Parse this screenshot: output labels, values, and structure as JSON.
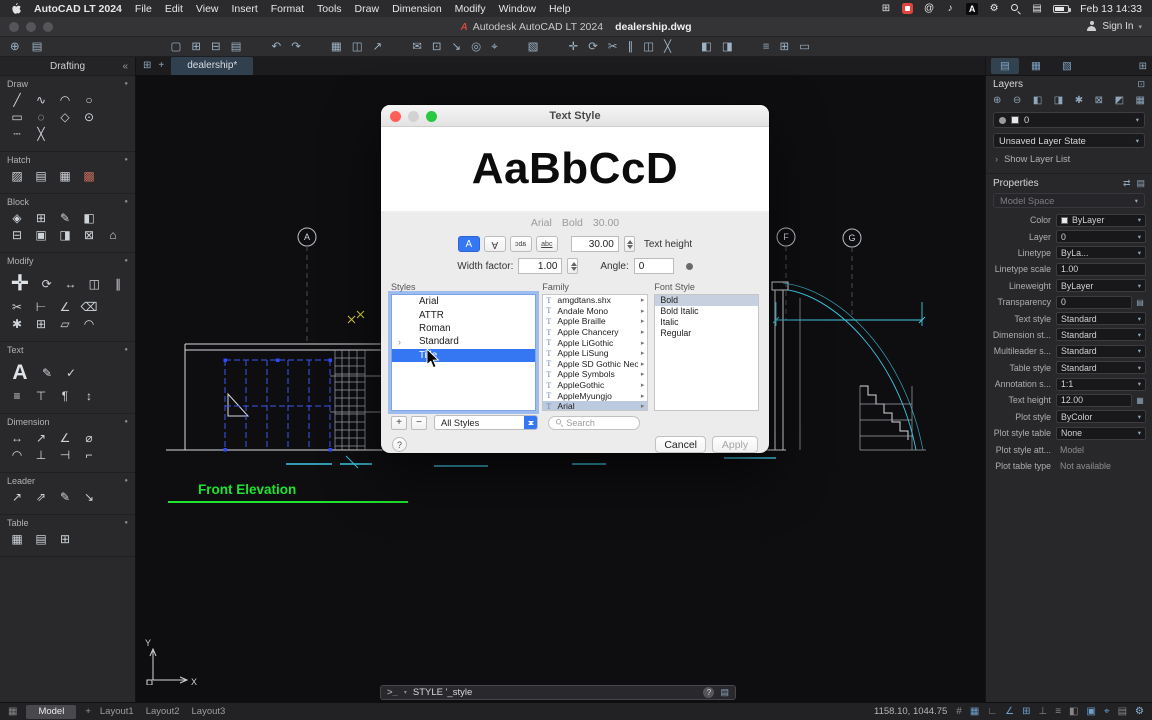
{
  "menubar": {
    "app_name": "AutoCAD LT 2024",
    "items": [
      "File",
      "Edit",
      "View",
      "Insert",
      "Format",
      "Tools",
      "Draw",
      "Dimension",
      "Modify",
      "Window",
      "Help"
    ],
    "status_icons": [
      {
        "name": "display-icon",
        "glyph": "⊞"
      },
      {
        "name": "screen-record-icon",
        "cls": "rec"
      },
      {
        "name": "at-circle-icon",
        "glyph": "@"
      },
      {
        "name": "volume-icon",
        "glyph": "♪"
      },
      {
        "name": "input-source-icon",
        "glyph": "A",
        "cls": "boxed"
      },
      {
        "name": "gear-icon",
        "glyph": "⚙"
      },
      {
        "name": "spotlight-search-icon",
        "cls": "mag"
      },
      {
        "name": "control-center-icon",
        "glyph": "▤"
      },
      {
        "name": "battery-icon",
        "cls": "battery"
      }
    ],
    "clock": "Feb 13 14:33"
  },
  "titlebar": {
    "app_title": "Autodesk AutoCAD LT 2024",
    "doc_name": "dealership.dwg",
    "sign_in_label": "Sign In"
  },
  "toolbar": {
    "groups": [
      [
        {
          "name": "new",
          "glyph": "▢"
        },
        {
          "name": "open",
          "glyph": "⊞"
        },
        {
          "name": "save",
          "glyph": "⊟"
        },
        {
          "name": "print",
          "glyph": "▤"
        }
      ],
      [
        {
          "name": "undo",
          "glyph": "↶"
        },
        {
          "name": "redo",
          "glyph": "↷"
        }
      ],
      [
        {
          "name": "plot",
          "glyph": "▦"
        },
        {
          "name": "plot-preview",
          "glyph": "◫"
        },
        {
          "name": "publish",
          "glyph": "↗"
        }
      ],
      [
        {
          "name": "mail",
          "glyph": "✉"
        },
        {
          "name": "layout",
          "glyph": "⊡"
        },
        {
          "name": "import",
          "glyph": "↘"
        },
        {
          "name": "osnap",
          "glyph": "◎"
        },
        {
          "name": "center",
          "glyph": "⌖"
        }
      ],
      [
        {
          "name": "measure",
          "glyph": "▧"
        }
      ],
      [
        {
          "name": "move",
          "glyph": "✛"
        },
        {
          "name": "rotate",
          "glyph": "⟳"
        },
        {
          "name": "trim",
          "glyph": "✂"
        },
        {
          "name": "offset",
          "glyph": "∥"
        },
        {
          "name": "mirror",
          "glyph": "◫"
        },
        {
          "name": "erase",
          "glyph": "╳"
        }
      ],
      [
        {
          "name": "group",
          "glyph": "◧"
        },
        {
          "name": "ungroup",
          "glyph": "◨"
        }
      ],
      [
        {
          "name": "list",
          "glyph": "≡"
        },
        {
          "name": "grid-view",
          "glyph": "⊞"
        },
        {
          "name": "properties",
          "glyph": "▭"
        }
      ]
    ]
  },
  "doc_tabs": {
    "active": "dealership*"
  },
  "left_panel": {
    "title": "Drafting",
    "sections": [
      {
        "label": "Draw",
        "rows": [
          [
            {
              "n": "line",
              "g": "╱"
            },
            {
              "n": "polyline",
              "g": "∿"
            },
            {
              "n": "arc",
              "g": "◠"
            },
            {
              "n": "circle",
              "g": "○"
            }
          ],
          [
            {
              "n": "rectangle",
              "g": "▭"
            },
            {
              "n": "ellipse",
              "g": "◌"
            },
            {
              "n": "polygon",
              "g": "◇"
            },
            {
              "n": "point",
              "g": "⊙"
            }
          ],
          [
            {
              "n": "construction-line",
              "g": "┄"
            },
            {
              "n": "xline",
              "g": "╳"
            }
          ]
        ]
      },
      {
        "label": "Hatch",
        "rows": [
          [
            {
              "n": "hatch",
              "g": "▨"
            },
            {
              "n": "gradient",
              "g": "▤"
            },
            {
              "n": "boundary",
              "g": "▦"
            },
            {
              "n": "solid-fill",
              "g": "▩",
              "c": "#c26a5a"
            }
          ]
        ]
      },
      {
        "label": "Block",
        "rows": [
          [
            {
              "n": "insert-block",
              "g": "◈"
            },
            {
              "n": "create-block",
              "g": "⊞"
            },
            {
              "n": "edit-block",
              "g": "✎"
            },
            {
              "n": "define-attributes",
              "g": "◧"
            }
          ],
          [
            {
              "n": "write-block",
              "g": "⊟"
            },
            {
              "n": "base-point",
              "g": "▣"
            },
            {
              "n": "attach",
              "g": "◨"
            },
            {
              "n": "clip",
              "g": "⊠"
            },
            {
              "n": "adjust",
              "g": "⌂"
            }
          ]
        ]
      },
      {
        "label": "Modify",
        "rows": [
          [
            {
              "n": "move",
              "g": "✛",
              "big": true
            },
            {
              "n": "rotate",
              "g": "⟳"
            },
            {
              "n": "stretch",
              "g": "↔"
            },
            {
              "n": "mirror",
              "g": "◫"
            },
            {
              "n": "offset",
              "g": "∥"
            }
          ],
          [
            {
              "n": "trim",
              "g": "✂"
            },
            {
              "n": "extend",
              "g": "⊢"
            },
            {
              "n": "chamfer",
              "g": "∠"
            },
            {
              "n": "erase",
              "g": "⌫"
            }
          ],
          [
            {
              "n": "explode",
              "g": "✱"
            },
            {
              "n": "array",
              "g": "⊞"
            },
            {
              "n": "scale",
              "g": "▱"
            },
            {
              "n": "fillet",
              "g": "◠"
            }
          ]
        ]
      },
      {
        "label": "Text",
        "rows": [
          [
            {
              "n": "multiline-text",
              "g": "A",
              "big": true
            },
            {
              "n": "edit-text",
              "g": "✎"
            },
            {
              "n": "spell-check",
              "g": "✓"
            }
          ],
          [
            {
              "n": "text-align",
              "g": "≡"
            },
            {
              "n": "text-style",
              "g": "⊤"
            },
            {
              "n": "paragraph",
              "g": "¶"
            },
            {
              "n": "text-height",
              "g": "↕"
            }
          ]
        ]
      },
      {
        "label": "Dimension",
        "rows": [
          [
            {
              "n": "linear-dimension",
              "g": "↔"
            },
            {
              "n": "aligned-dimension",
              "g": "↗"
            },
            {
              "n": "angular-dimension",
              "g": "∠"
            },
            {
              "n": "diameter-dimension",
              "g": "⌀"
            }
          ],
          [
            {
              "n": "arc-length",
              "g": "◠"
            },
            {
              "n": "perpendicular",
              "g": "⊥"
            },
            {
              "n": "baseline",
              "g": "⊣"
            },
            {
              "n": "ordinate",
              "g": "⌐"
            }
          ]
        ]
      },
      {
        "label": "Leader",
        "rows": [
          [
            {
              "n": "multileader",
              "g": "↗"
            },
            {
              "n": "add-leader",
              "g": "⇗"
            },
            {
              "n": "edit-leader",
              "g": "✎"
            },
            {
              "n": "align-leader",
              "g": "↘"
            }
          ]
        ]
      },
      {
        "label": "Table",
        "rows": [
          [
            {
              "n": "table",
              "g": "▦"
            },
            {
              "n": "table-style",
              "g": "▤"
            },
            {
              "n": "insert-table",
              "g": "⊞"
            }
          ]
        ]
      }
    ]
  },
  "canvas": {
    "bubbles": [
      "A",
      "F",
      "G"
    ],
    "label": "Front Elevation",
    "ucs": {
      "x": "X",
      "y": "Y"
    }
  },
  "dialog": {
    "title": "Text Style",
    "preview_text": "AaBbCcD",
    "preview_font": "Arial",
    "preview_style": "Bold",
    "preview_size": "30.00",
    "toggles": [
      {
        "name": "annotative-toggle",
        "glyph": "A",
        "on": true
      },
      {
        "name": "upside-down-toggle",
        "glyph": "A",
        "cls": "flip"
      },
      {
        "name": "backwards-toggle",
        "glyph": "abc",
        "cls": "mirror"
      },
      {
        "name": "vertical-toggle",
        "glyph": "abc",
        "cls": "under"
      }
    ],
    "text_height_value": "30.00",
    "text_height_label": "Text height",
    "width_factor_label": "Width factor:",
    "width_factor_value": "1.00",
    "angle_label": "Angle:",
    "angle_value": "0",
    "styles_label": "Styles",
    "styles": [
      "Arial",
      "ATTR",
      "Roman",
      "Standard",
      "Title"
    ],
    "selected_style": "Title",
    "disclosure_style": "Standard",
    "family_label": "Family",
    "families": [
      "amgdtans.shx",
      "Andale Mono",
      "Apple Braille",
      "Apple Chancery",
      "Apple LiGothic",
      "Apple LiSung",
      "Apple SD Gothic Neo",
      "Apple Symbols",
      "AppleGothic",
      "AppleMyungjo",
      "Arial"
    ],
    "selected_family": "Arial",
    "font_style_label": "Font Style",
    "font_styles": [
      "Bold",
      "Bold Italic",
      "Italic",
      "Regular"
    ],
    "selected_font_style": "Bold",
    "add_label": "+",
    "remove_label": "−",
    "filter_value": "All Styles",
    "search_placeholder": "Search",
    "help_label": "?",
    "cancel_label": "Cancel",
    "apply_label": "Apply"
  },
  "right_panel": {
    "panel_tabs": [
      {
        "name": "palette-tab-layers",
        "glyph": "▤"
      },
      {
        "name": "palette-tab-properties",
        "glyph": "▦"
      },
      {
        "name": "palette-tab-reference",
        "glyph": "▧"
      }
    ],
    "corner_icon": {
      "name": "panel-grid-icon",
      "glyph": "⊞"
    },
    "layers": {
      "title": "Layers",
      "tool_icons": [
        {
          "name": "new-layer-icon",
          "glyph": "⊕"
        },
        {
          "name": "delete-layer-icon",
          "glyph": "⊖"
        },
        {
          "name": "layer-isolate-icon",
          "glyph": "◧"
        },
        {
          "name": "layer-unisolate-icon",
          "glyph": "◨"
        },
        {
          "name": "layer-freeze-icon",
          "glyph": "✱"
        },
        {
          "name": "layer-lock-icon",
          "glyph": "⊠"
        },
        {
          "name": "layer-off-icon",
          "glyph": "◩"
        },
        {
          "name": "layer-merge-icon",
          "glyph": "▦"
        }
      ],
      "current_layer": "0",
      "layer_state": "Unsaved Layer State",
      "show_layer_list": "Show Layer List"
    },
    "properties": {
      "title": "Properties",
      "space": "Model Space",
      "rows": [
        {
          "label": "Color",
          "value": "ByLayer",
          "kind": "dropdown",
          "swatch": true
        },
        {
          "label": "Layer",
          "value": "0",
          "kind": "dropdown"
        },
        {
          "label": "Linetype",
          "value": "ByLa...",
          "kind": "dropdown"
        },
        {
          "label": "Linetype scale",
          "value": "1.00",
          "kind": "input"
        },
        {
          "label": "Lineweight",
          "value": "ByLayer",
          "kind": "dropdown"
        },
        {
          "label": "Transparency",
          "value": "0",
          "kind": "input",
          "extra": "page"
        },
        {
          "label": "Text style",
          "value": "Standard",
          "kind": "dropdown"
        },
        {
          "label": "Dimension st...",
          "value": "Standard",
          "kind": "dropdown"
        },
        {
          "label": "Multileader s...",
          "value": "Standard",
          "kind": "dropdown"
        },
        {
          "label": "Table style",
          "value": "Standard",
          "kind": "dropdown"
        },
        {
          "label": "Annotation s...",
          "value": "1:1",
          "kind": "dropdown"
        },
        {
          "label": "Text height",
          "value": "12.00",
          "kind": "input",
          "extra": "grid"
        },
        {
          "label": "Plot style",
          "value": "ByColor",
          "kind": "dropdown"
        },
        {
          "label": "Plot style table",
          "value": "None",
          "kind": "dropdown"
        },
        {
          "label": "Plot style att...",
          "value": "Model",
          "kind": "text"
        },
        {
          "label": "Plot table type",
          "value": "Not available",
          "kind": "text"
        }
      ]
    }
  },
  "command_bar": {
    "prompt": ">_",
    "text": "STYLE '_style",
    "help": "?"
  },
  "statusbar": {
    "model_tab": "Model",
    "add_label": "+",
    "layout_tabs": [
      "Layout1",
      "Layout2",
      "Layout3"
    ],
    "coords": "1158.10, 1044.75",
    "icons": [
      {
        "name": "snap-mode",
        "glyph": "#",
        "c": "#86868a"
      },
      {
        "name": "grid-display",
        "glyph": "▦",
        "c": "#6f9fcc"
      },
      {
        "name": "ortho-mode",
        "glyph": "∟",
        "c": "#86868a"
      },
      {
        "name": "polar-tracking",
        "glyph": "∠",
        "c": "#6f9fcc"
      },
      {
        "name": "object-snap",
        "glyph": "⊞",
        "c": "#6f9fcc"
      },
      {
        "name": "object-snap-tracking",
        "glyph": "⊥",
        "c": "#86868a"
      },
      {
        "name": "lineweight-display",
        "glyph": "≡",
        "c": "#86868a"
      },
      {
        "name": "isolate-objects",
        "glyph": "◧",
        "c": "#86868a"
      },
      {
        "name": "annotation-scale",
        "glyph": "▣",
        "c": "#6f9fcc"
      },
      {
        "name": "annotation-visibility",
        "glyph": "⌖",
        "c": "#6f9fcc"
      },
      {
        "name": "workspace-switching",
        "glyph": "▤",
        "c": "#86868a"
      },
      {
        "name": "settings-gear",
        "glyph": "⚙",
        "c": "#8fb4d8"
      }
    ]
  },
  "colors": {
    "accent_blue": "#3577f2",
    "selection_blue": "#3b55f0",
    "cad_cyan": "#3ec9e4",
    "cad_green": "#1fe42d",
    "record_red": "#e0443e"
  }
}
